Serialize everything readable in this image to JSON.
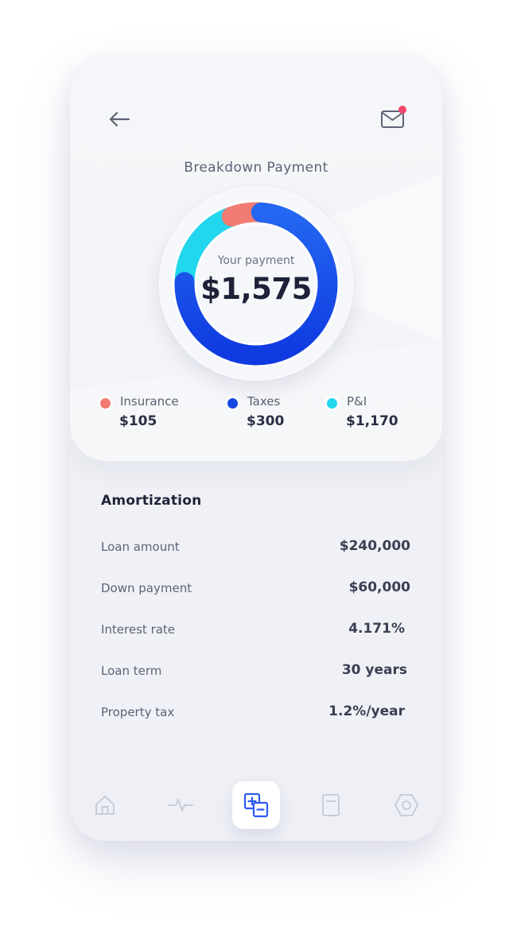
{
  "header": {
    "title": "Breakdown Payment",
    "back_icon": "arrow-left-icon",
    "mail_icon": "mail-icon",
    "notification_color": "#f0466b"
  },
  "payment": {
    "label": "Your payment",
    "value": "$1,575"
  },
  "chart_data": {
    "type": "pie",
    "title": "",
    "segments": [
      {
        "name": "Insurance",
        "value": 105,
        "color": "#f27b73"
      },
      {
        "name": "Taxes",
        "value": 300,
        "color": "#1747e0"
      },
      {
        "name": "P&I",
        "value": 1170,
        "color": "#22d6ee"
      }
    ]
  },
  "legend": [
    {
      "label": "Insurance",
      "value": "$105",
      "color": "#f27b73"
    },
    {
      "label": "Taxes",
      "value": "$300",
      "color": "#1747e0"
    },
    {
      "label": "P&I",
      "value": "$1,170",
      "color": "#22d6ee"
    }
  ],
  "amortization": {
    "title": "Amortization",
    "rows": [
      {
        "label": "Loan amount",
        "value": "$240,000"
      },
      {
        "label": "Down payment",
        "value": "$60,000"
      },
      {
        "label": "Interest rate",
        "value": "4.171%"
      },
      {
        "label": "Loan term",
        "value": "30 years"
      },
      {
        "label": "Property tax",
        "value": "1.2%/year"
      }
    ]
  },
  "tabbar": {
    "tabs": [
      {
        "icon": "home-icon",
        "active": false
      },
      {
        "icon": "activity-icon",
        "active": false
      },
      {
        "icon": "calculator-icon",
        "active": true
      },
      {
        "icon": "document-icon",
        "active": false
      },
      {
        "icon": "settings-hexagon-icon",
        "active": false
      }
    ],
    "accent": "#2c5bf0",
    "inactive_color": "#c9ccd9"
  }
}
